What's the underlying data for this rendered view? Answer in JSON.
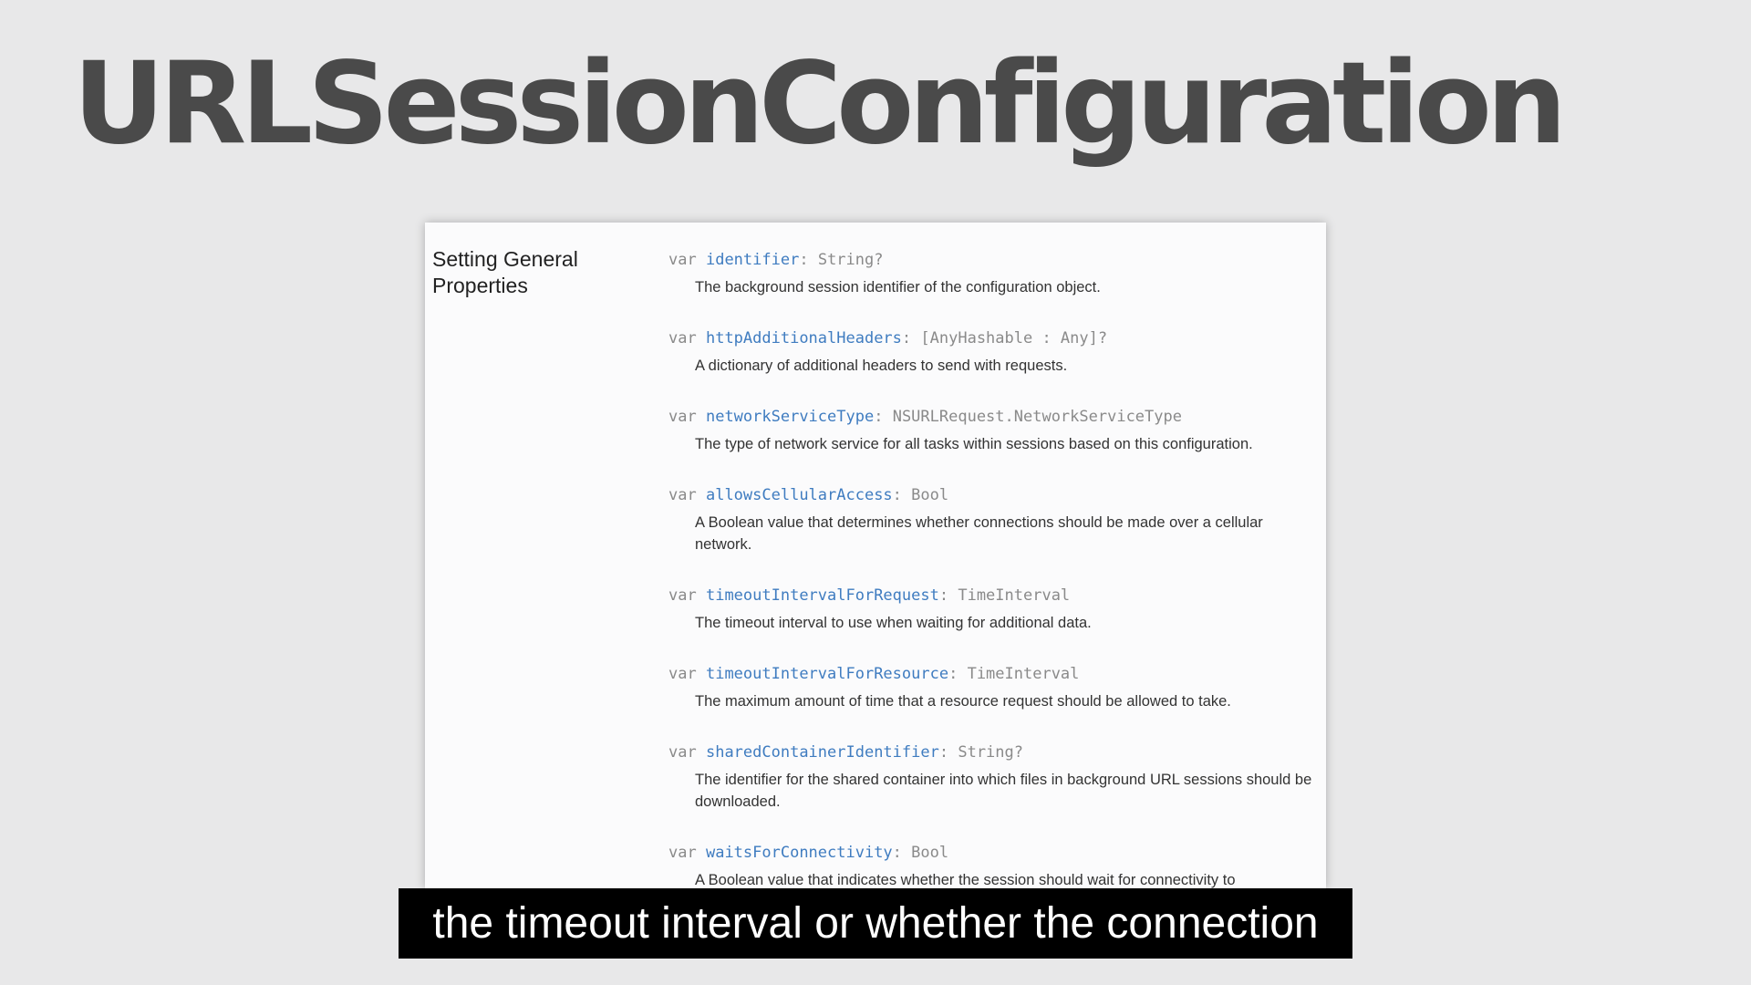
{
  "slide": {
    "title": "URLSessionConfiguration"
  },
  "doc": {
    "section_heading": "Setting General Properties",
    "properties": [
      {
        "keyword": "var",
        "name": "identifier",
        "separator": ":",
        "type": "String?",
        "description": "The background session identifier of the configuration object."
      },
      {
        "keyword": "var",
        "name": "httpAdditionalHeaders",
        "separator": ":",
        "type": "[AnyHashable : Any]?",
        "description": "A dictionary of additional headers to send with requests."
      },
      {
        "keyword": "var",
        "name": "networkServiceType",
        "separator": ":",
        "type": "NSURLRequest.NetworkServiceType",
        "description": "The type of network service for all tasks within sessions based on this configuration."
      },
      {
        "keyword": "var",
        "name": "allowsCellularAccess",
        "separator": ":",
        "type": "Bool",
        "description": "A Boolean value that determines whether connections should be made over a cellular network."
      },
      {
        "keyword": "var",
        "name": "timeoutIntervalForRequest",
        "separator": ":",
        "type": "TimeInterval",
        "description": "The timeout interval to use when waiting for additional data."
      },
      {
        "keyword": "var",
        "name": "timeoutIntervalForResource",
        "separator": ":",
        "type": "TimeInterval",
        "description": "The maximum amount of time that a resource request should be allowed to take."
      },
      {
        "keyword": "var",
        "name": "sharedContainerIdentifier",
        "separator": ":",
        "type": "String?",
        "description": "The identifier for the shared container into which files in background URL sessions should be downloaded."
      },
      {
        "keyword": "var",
        "name": "waitsForConnectivity",
        "separator": ":",
        "type": "Bool",
        "description": "A Boolean value that indicates whether the session should wait for connectivity to"
      }
    ]
  },
  "caption": {
    "text": "the timeout interval or whether the connection"
  },
  "colors": {
    "background": "#e8e8e9",
    "title": "#4a4a4a",
    "symbol_link": "#3f7cc0",
    "code_gray": "#8a8a8a",
    "caption_bg": "#000000",
    "caption_text": "#ffffff"
  }
}
